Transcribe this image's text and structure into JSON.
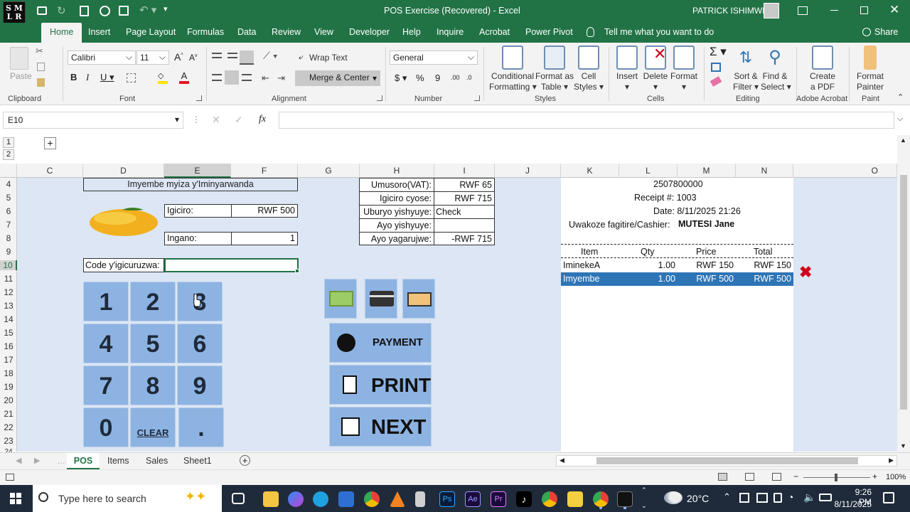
{
  "title": {
    "window_title": "POS Exercise (Recovered)  -  Excel",
    "user": "PATRICK ISHIMWE"
  },
  "ribbon_tabs": [
    "Home",
    "Insert",
    "Page Layout",
    "Formulas",
    "Data",
    "Review",
    "View",
    "Developer",
    "Help",
    "Inquire",
    "Acrobat",
    "Power Pivot"
  ],
  "tell_me": "Tell me what you want to do",
  "share": "Share",
  "ribbon": {
    "paste": "Paste",
    "font_name": "Calibri",
    "font_size": "11",
    "wrap_text": "Wrap Text",
    "merge_center": "Merge & Center",
    "number_format": "General",
    "conditional": [
      "Conditional",
      "Formatting"
    ],
    "format_table": [
      "Format as",
      "Table"
    ],
    "cell_styles": [
      "Cell",
      "Styles"
    ],
    "insert": "Insert",
    "delete": "Delete",
    "format": "Format",
    "sort_filter": [
      "Sort &",
      "Filter"
    ],
    "find_select": [
      "Find &",
      "Select"
    ],
    "create_pdf": [
      "Create",
      "a PDF"
    ],
    "format_painter": [
      "Format",
      "Painter"
    ],
    "groups": [
      "Clipboard",
      "Font",
      "Alignment",
      "Number",
      "Styles",
      "Cells",
      "Editing",
      "Adobe Acrobat",
      "Paint"
    ]
  },
  "formula_bar": {
    "name_box": "E10",
    "fx": "fx",
    "value": ""
  },
  "outline": {
    "levels": [
      "1",
      "2"
    ],
    "expand": "+"
  },
  "columns": [
    "C",
    "D",
    "E",
    "F",
    "G",
    "H",
    "I",
    "J",
    "K",
    "L",
    "M",
    "N",
    "O"
  ],
  "rows": [
    "4",
    "5",
    "6",
    "7",
    "8",
    "9",
    "10",
    "11",
    "12",
    "13",
    "14",
    "15",
    "16",
    "17",
    "18",
    "19",
    "20",
    "21",
    "22",
    "23",
    "24"
  ],
  "pos": {
    "product_name": "Imyembe myiza y'Iminyarwanda",
    "price_label": "Igiciro:",
    "price_value": "RWF 500",
    "qty_label": "Ingano:",
    "qty_value": "1",
    "code_label": "Code y'igicuruzwa:",
    "code_value": "",
    "keys": [
      "1",
      "2",
      "3",
      "4",
      "5",
      "6",
      "7",
      "8",
      "9",
      "0",
      "CLEAR",
      "."
    ],
    "summary": [
      {
        "label": "Umusoro(VAT):",
        "value": "RWF 65"
      },
      {
        "label": "Igiciro cyose:",
        "value": "RWF 715"
      },
      {
        "label": "Uburyo yishyuye:",
        "value": "Check"
      },
      {
        "label": "Ayo yishyuye:",
        "value": ""
      },
      {
        "label": "Ayo yagarujwe:",
        "value": "-RWF 715"
      }
    ],
    "payment_button": "PAYMENT",
    "print_button": "PRINT",
    "next_button": "NEXT"
  },
  "receipt": {
    "phone": "2507800000",
    "receipt_no": "Receipt #:  1003",
    "date": "Date:  8/11/2025 21:26",
    "cashier_label": "Uwakoze fagitire/Cashier:",
    "cashier_name": "MUTESI Jane",
    "headers": [
      "Item",
      "Qty",
      "Price",
      "Total"
    ],
    "lines": [
      {
        "item": "IminekeA",
        "qty": "1.00",
        "price": "RWF 150",
        "total": "RWF 150"
      },
      {
        "item": "Imyembe",
        "qty": "1.00",
        "price": "RWF 500",
        "total": "RWF 500"
      }
    ]
  },
  "sheet_tabs": [
    "POS",
    "Items",
    "Sales",
    "Sheet1"
  ],
  "status": {
    "zoom": "100%"
  },
  "taskbar": {
    "search": "Type here to search",
    "temp": "20°C",
    "time": "9:26 PM",
    "date": "8/11/2025"
  },
  "colors": {
    "excel_green": "#217346",
    "pos_bg": "#dce6f4",
    "key_blue": "#8db3e2",
    "selection": "#2e75b6",
    "delete_red": "#d0021b"
  }
}
